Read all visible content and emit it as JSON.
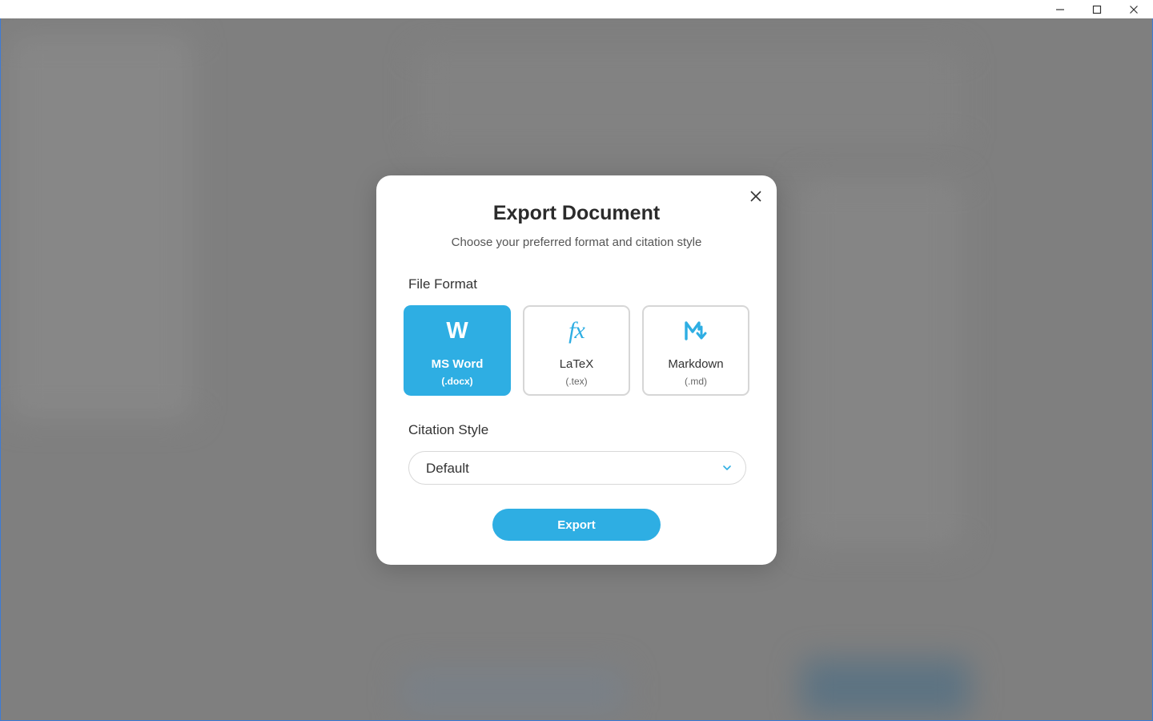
{
  "window": {
    "controls": {
      "minimize_icon": "minimize-icon",
      "maximize_icon": "maximize-icon",
      "close_icon": "close-icon"
    }
  },
  "dialog": {
    "title": "Export Document",
    "subtitle": "Choose your preferred format and citation style",
    "close_icon": "close-icon",
    "file_format": {
      "label": "File Format",
      "options": [
        {
          "icon": "word-icon",
          "glyph": "W",
          "name": "MS Word",
          "ext": "(.docx)",
          "selected": true
        },
        {
          "icon": "fx-icon",
          "glyph": "fx",
          "name": "LaTeX",
          "ext": "(.tex)",
          "selected": false
        },
        {
          "icon": "markdown-icon",
          "glyph": "M",
          "name": "Markdown",
          "ext": "(.md)",
          "selected": false
        }
      ]
    },
    "citation_style": {
      "label": "Citation Style",
      "value": "Default",
      "chevron_icon": "chevron-down-icon"
    },
    "export_label": "Export"
  },
  "colors": {
    "accent": "#2eaee3",
    "overlay": "#7d7d7d",
    "dialog_bg": "#ffffff",
    "window_frame": "#3d7bd6"
  }
}
